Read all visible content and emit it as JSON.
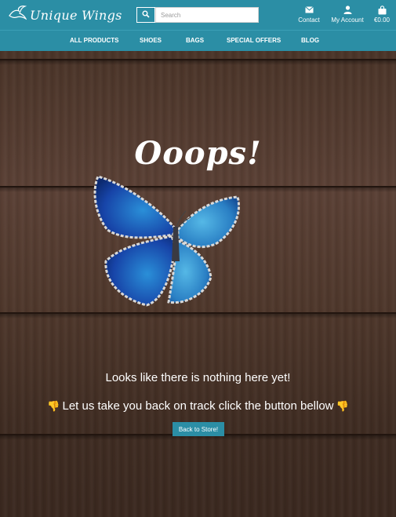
{
  "brand": {
    "name": "Unique Wings",
    "accent": "#2b8ea5"
  },
  "search": {
    "placeholder": "Search"
  },
  "top_actions": {
    "contact": "Contact",
    "account": "My Account",
    "cart": "€0.00"
  },
  "nav": {
    "items": [
      "ALL PRODUCTS",
      "SHOES",
      "BAGS",
      "SPECIAL OFFERS",
      "BLOG"
    ]
  },
  "error": {
    "title": "Ooops!",
    "message": "Looks like there is nothing here yet!",
    "instruction": "Let us take you back on track click the button bellow",
    "button": "Back to Store!"
  },
  "icons": [
    "bird-logo-icon",
    "search-icon",
    "envelope-icon",
    "user-icon",
    "shopping-bag-icon",
    "pointing-hand-icon",
    "butterfly-image"
  ]
}
